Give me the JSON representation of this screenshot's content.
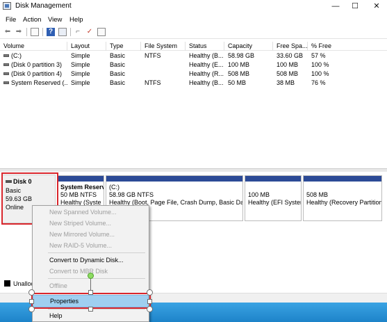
{
  "window": {
    "title": "Disk Management",
    "minimize_glyph": "—",
    "maximize_glyph": "☐",
    "close_glyph": "✕"
  },
  "menu": [
    "File",
    "Action",
    "View",
    "Help"
  ],
  "toolbar_icons": [
    "back-arrow-icon",
    "forward-arrow-icon",
    "show-hide-console-tree-icon",
    "help-icon",
    "properties-icon",
    "connect-disk-icon",
    "check-icon",
    "list-view-icon"
  ],
  "list": {
    "columns": [
      "Volume",
      "Layout",
      "Type",
      "File System",
      "Status",
      "Capacity",
      "Free Spa...",
      "% Free"
    ],
    "rows": [
      [
        "(C:)",
        "Simple",
        "Basic",
        "NTFS",
        "Healthy (B...",
        "58.98 GB",
        "33.60 GB",
        "57 %"
      ],
      [
        "(Disk 0 partition 3)",
        "Simple",
        "Basic",
        "",
        "Healthy (E...",
        "100 MB",
        "100 MB",
        "100 %"
      ],
      [
        "(Disk 0 partition 4)",
        "Simple",
        "Basic",
        "",
        "Healthy (R...",
        "508 MB",
        "508 MB",
        "100 %"
      ],
      [
        "System Reserved (...",
        "Simple",
        "Basic",
        "NTFS",
        "Healthy (B...",
        "50 MB",
        "38 MB",
        "76 %"
      ]
    ]
  },
  "disk": {
    "name": "Disk 0",
    "type": "Basic",
    "size": "59.63 GB",
    "status": "Online"
  },
  "partitions": [
    {
      "line1": "System Reserv",
      "line2": "50 MB NTFS",
      "line3": "Healthy (Syste"
    },
    {
      "line1": "(C:)",
      "line2": "58.98 GB NTFS",
      "line3": "Healthy (Boot, Page File, Crash Dump, Basic Data"
    },
    {
      "line1": "",
      "line2": "100 MB",
      "line3": "Healthy (EFI Syster"
    },
    {
      "line1": "",
      "line2": "508 MB",
      "line3": "Healthy (Recovery Partition"
    }
  ],
  "legend": {
    "unallocated": "Unalloc"
  },
  "context_menu": {
    "items": [
      {
        "label": "New Spanned Volume...",
        "enabled": false
      },
      {
        "label": "New Striped Volume...",
        "enabled": false
      },
      {
        "label": "New Mirrored Volume...",
        "enabled": false
      },
      {
        "label": "New RAID-5 Volume...",
        "enabled": false
      },
      {
        "label": "Convert to Dynamic Disk...",
        "enabled": true
      },
      {
        "label": "Convert to MBR Disk",
        "enabled": false
      },
      {
        "label": "Offline",
        "enabled": false
      },
      {
        "label": "Properties",
        "enabled": true,
        "selected": true
      },
      {
        "label": "Help",
        "enabled": true
      }
    ]
  },
  "colors": {
    "partition_bar": "#2c4a96",
    "highlight_border": "#d9262c",
    "selected_item": "#9fcff0",
    "taskbar": "#1d83c9"
  }
}
